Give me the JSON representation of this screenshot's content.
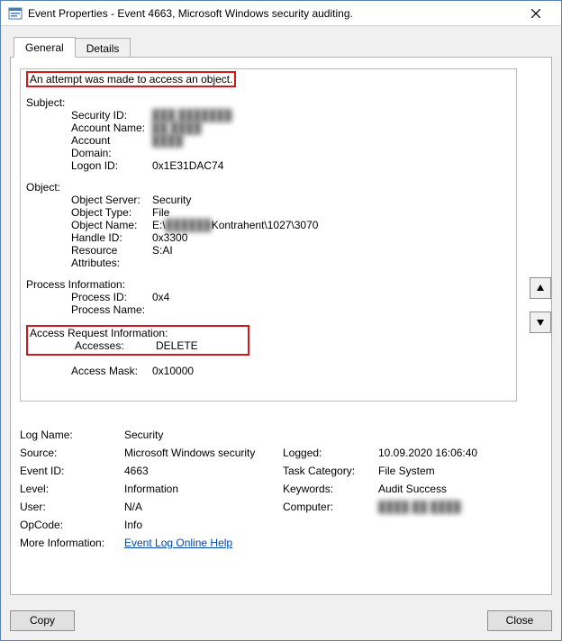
{
  "window": {
    "title": "Event Properties - Event 4663, Microsoft Windows security auditing."
  },
  "tabs": {
    "general": "General",
    "details": "Details"
  },
  "desc": {
    "headline": "An attempt was made to access an object.",
    "subject_hdr": "Subject:",
    "subject": {
      "security_id_k": "Security ID:",
      "security_id_v": "███ ███████",
      "account_name_k": "Account Name:",
      "account_name_v": "██ ████",
      "account_domain_k": "Account Domain:",
      "account_domain_v": "████",
      "logon_id_k": "Logon ID:",
      "logon_id_v": "0x1E31DAC74"
    },
    "object_hdr": "Object:",
    "object": {
      "server_k": "Object Server:",
      "server_v": "Security",
      "type_k": "Object Type:",
      "type_v": "File",
      "name_k": "Object Name:",
      "name_v_prefix": "E:\\",
      "name_v_blur": "██████",
      "name_v_suffix": "Kontrahent\\1027\\3070",
      "handle_k": "Handle ID:",
      "handle_v": "0x3300",
      "resattr_k": "Resource Attributes:",
      "resattr_v": "S:AI"
    },
    "proc_hdr": "Process Information:",
    "proc": {
      "pid_k": "Process ID:",
      "pid_v": "0x4",
      "pname_k": "Process Name:",
      "pname_v": ""
    },
    "access_hdr": "Access Request Information:",
    "access": {
      "accesses_k": "Accesses:",
      "accesses_v": "DELETE",
      "mask_k": "Access Mask:",
      "mask_v": "0x10000"
    }
  },
  "meta": {
    "logname_k": "Log Name:",
    "logname_v": "Security",
    "source_k": "Source:",
    "source_v": "Microsoft Windows security",
    "logged_k": "Logged:",
    "logged_v": "10.09.2020 16:06:40",
    "eventid_k": "Event ID:",
    "eventid_v": "4663",
    "taskcat_k": "Task Category:",
    "taskcat_v": "File System",
    "level_k": "Level:",
    "level_v": "Information",
    "keywords_k": "Keywords:",
    "keywords_v": "Audit Success",
    "user_k": "User:",
    "user_v": "N/A",
    "computer_k": "Computer:",
    "computer_v": "████ ██ ████",
    "opcode_k": "OpCode:",
    "opcode_v": "Info",
    "moreinfo_k": "More Information:",
    "moreinfo_link": "Event Log Online Help"
  },
  "footer": {
    "copy": "Copy",
    "close": "Close"
  }
}
